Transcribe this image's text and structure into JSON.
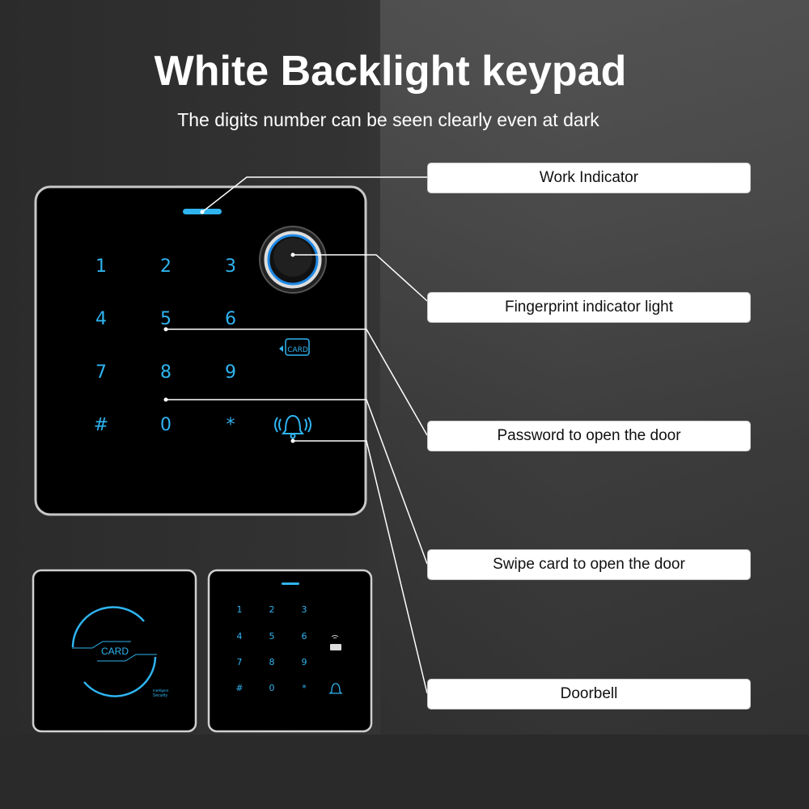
{
  "header": {
    "title": "White Backlight keypad",
    "subtitle": "The digits number can be seen clearly even at dark"
  },
  "callouts": [
    "Work Indicator",
    "Fingerprint indicator light",
    "Password to open the door",
    "Swipe card to open the door",
    "Doorbell"
  ],
  "keypad": {
    "keys": [
      "1",
      "2",
      "3",
      "4",
      "5",
      "6",
      "7",
      "8",
      "9",
      "#",
      "0",
      "*"
    ],
    "card_icon_text": "CARD"
  },
  "card_reader": {
    "card_text": "CARD",
    "brand_line1": "Intelligent",
    "brand_line2": "Security"
  },
  "colors": {
    "backlight": "#2fb4f0",
    "label_bg": "#ffffff"
  }
}
